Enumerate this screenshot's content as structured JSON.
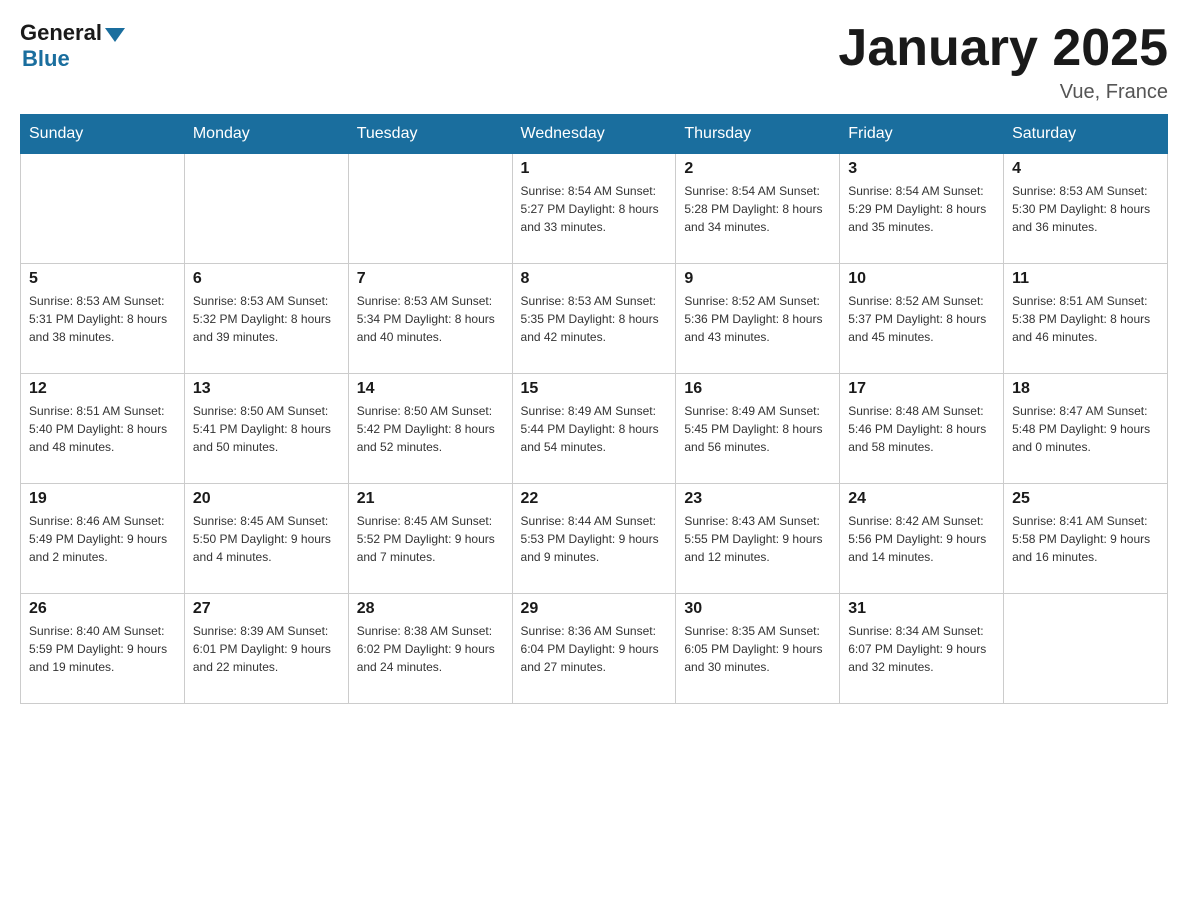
{
  "header": {
    "logo_general": "General",
    "logo_blue": "Blue",
    "month_title": "January 2025",
    "location": "Vue, France"
  },
  "days_of_week": [
    "Sunday",
    "Monday",
    "Tuesday",
    "Wednesday",
    "Thursday",
    "Friday",
    "Saturday"
  ],
  "weeks": [
    [
      {
        "day": "",
        "info": ""
      },
      {
        "day": "",
        "info": ""
      },
      {
        "day": "",
        "info": ""
      },
      {
        "day": "1",
        "info": "Sunrise: 8:54 AM\nSunset: 5:27 PM\nDaylight: 8 hours\nand 33 minutes."
      },
      {
        "day": "2",
        "info": "Sunrise: 8:54 AM\nSunset: 5:28 PM\nDaylight: 8 hours\nand 34 minutes."
      },
      {
        "day": "3",
        "info": "Sunrise: 8:54 AM\nSunset: 5:29 PM\nDaylight: 8 hours\nand 35 minutes."
      },
      {
        "day": "4",
        "info": "Sunrise: 8:53 AM\nSunset: 5:30 PM\nDaylight: 8 hours\nand 36 minutes."
      }
    ],
    [
      {
        "day": "5",
        "info": "Sunrise: 8:53 AM\nSunset: 5:31 PM\nDaylight: 8 hours\nand 38 minutes."
      },
      {
        "day": "6",
        "info": "Sunrise: 8:53 AM\nSunset: 5:32 PM\nDaylight: 8 hours\nand 39 minutes."
      },
      {
        "day": "7",
        "info": "Sunrise: 8:53 AM\nSunset: 5:34 PM\nDaylight: 8 hours\nand 40 minutes."
      },
      {
        "day": "8",
        "info": "Sunrise: 8:53 AM\nSunset: 5:35 PM\nDaylight: 8 hours\nand 42 minutes."
      },
      {
        "day": "9",
        "info": "Sunrise: 8:52 AM\nSunset: 5:36 PM\nDaylight: 8 hours\nand 43 minutes."
      },
      {
        "day": "10",
        "info": "Sunrise: 8:52 AM\nSunset: 5:37 PM\nDaylight: 8 hours\nand 45 minutes."
      },
      {
        "day": "11",
        "info": "Sunrise: 8:51 AM\nSunset: 5:38 PM\nDaylight: 8 hours\nand 46 minutes."
      }
    ],
    [
      {
        "day": "12",
        "info": "Sunrise: 8:51 AM\nSunset: 5:40 PM\nDaylight: 8 hours\nand 48 minutes."
      },
      {
        "day": "13",
        "info": "Sunrise: 8:50 AM\nSunset: 5:41 PM\nDaylight: 8 hours\nand 50 minutes."
      },
      {
        "day": "14",
        "info": "Sunrise: 8:50 AM\nSunset: 5:42 PM\nDaylight: 8 hours\nand 52 minutes."
      },
      {
        "day": "15",
        "info": "Sunrise: 8:49 AM\nSunset: 5:44 PM\nDaylight: 8 hours\nand 54 minutes."
      },
      {
        "day": "16",
        "info": "Sunrise: 8:49 AM\nSunset: 5:45 PM\nDaylight: 8 hours\nand 56 minutes."
      },
      {
        "day": "17",
        "info": "Sunrise: 8:48 AM\nSunset: 5:46 PM\nDaylight: 8 hours\nand 58 minutes."
      },
      {
        "day": "18",
        "info": "Sunrise: 8:47 AM\nSunset: 5:48 PM\nDaylight: 9 hours\nand 0 minutes."
      }
    ],
    [
      {
        "day": "19",
        "info": "Sunrise: 8:46 AM\nSunset: 5:49 PM\nDaylight: 9 hours\nand 2 minutes."
      },
      {
        "day": "20",
        "info": "Sunrise: 8:45 AM\nSunset: 5:50 PM\nDaylight: 9 hours\nand 4 minutes."
      },
      {
        "day": "21",
        "info": "Sunrise: 8:45 AM\nSunset: 5:52 PM\nDaylight: 9 hours\nand 7 minutes."
      },
      {
        "day": "22",
        "info": "Sunrise: 8:44 AM\nSunset: 5:53 PM\nDaylight: 9 hours\nand 9 minutes."
      },
      {
        "day": "23",
        "info": "Sunrise: 8:43 AM\nSunset: 5:55 PM\nDaylight: 9 hours\nand 12 minutes."
      },
      {
        "day": "24",
        "info": "Sunrise: 8:42 AM\nSunset: 5:56 PM\nDaylight: 9 hours\nand 14 minutes."
      },
      {
        "day": "25",
        "info": "Sunrise: 8:41 AM\nSunset: 5:58 PM\nDaylight: 9 hours\nand 16 minutes."
      }
    ],
    [
      {
        "day": "26",
        "info": "Sunrise: 8:40 AM\nSunset: 5:59 PM\nDaylight: 9 hours\nand 19 minutes."
      },
      {
        "day": "27",
        "info": "Sunrise: 8:39 AM\nSunset: 6:01 PM\nDaylight: 9 hours\nand 22 minutes."
      },
      {
        "day": "28",
        "info": "Sunrise: 8:38 AM\nSunset: 6:02 PM\nDaylight: 9 hours\nand 24 minutes."
      },
      {
        "day": "29",
        "info": "Sunrise: 8:36 AM\nSunset: 6:04 PM\nDaylight: 9 hours\nand 27 minutes."
      },
      {
        "day": "30",
        "info": "Sunrise: 8:35 AM\nSunset: 6:05 PM\nDaylight: 9 hours\nand 30 minutes."
      },
      {
        "day": "31",
        "info": "Sunrise: 8:34 AM\nSunset: 6:07 PM\nDaylight: 9 hours\nand 32 minutes."
      },
      {
        "day": "",
        "info": ""
      }
    ]
  ]
}
